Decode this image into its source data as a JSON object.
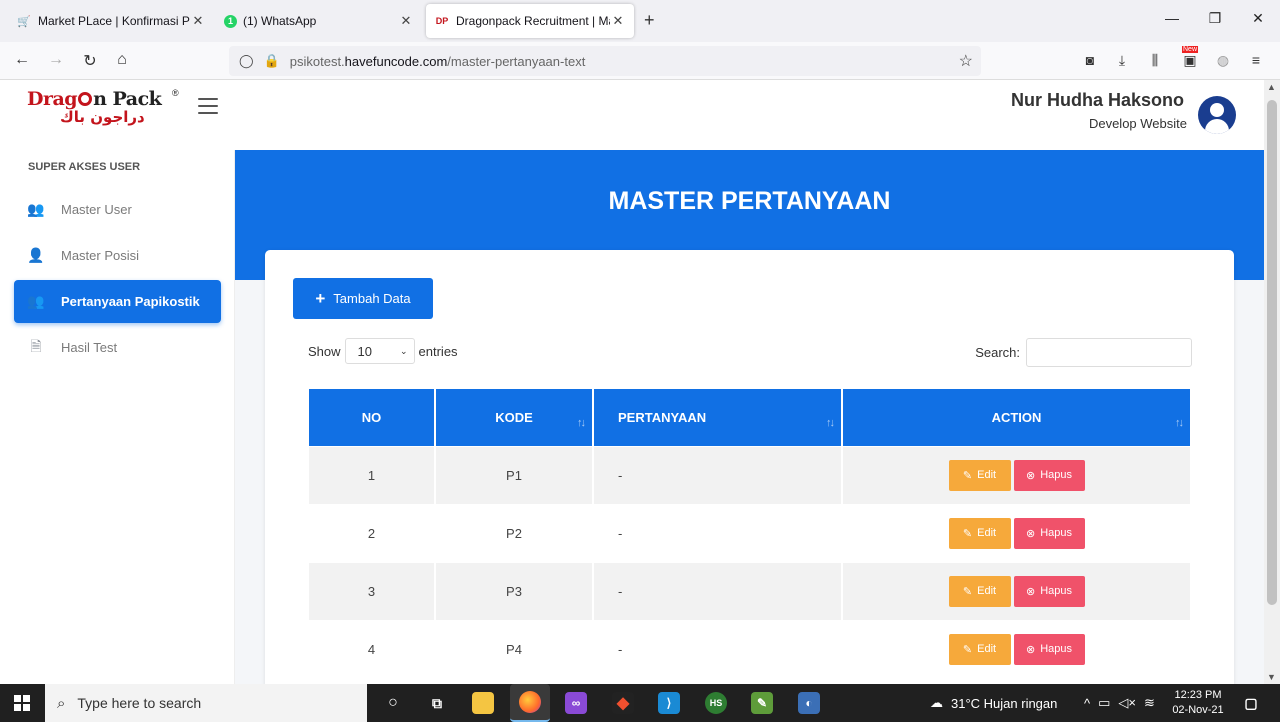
{
  "browser": {
    "tabs": [
      {
        "label": "Market PLace | Konfirmasi Pemb",
        "icon": "cart-icon"
      },
      {
        "label": "(1) WhatsApp",
        "icon": "whatsapp-icon",
        "badge": "1"
      },
      {
        "label": "Dragonpack Recruitment | Mast",
        "icon": "dragonpack-icon"
      }
    ],
    "url_prefix": "psikotest.",
    "url_host": "havefuncode.com",
    "url_path": "/master-pertanyaan-text",
    "new_badge": "New"
  },
  "header": {
    "logo_text_1": "Drag",
    "logo_text_2": "n Pack",
    "logo_arabic": "دراجون باك",
    "logo_reg": "®",
    "user_name": "Nur Hudha Haksono",
    "user_role": "Develop Website"
  },
  "sidebar": {
    "section_title": "SUPER AKSES USER",
    "items": [
      {
        "label": "Master User",
        "icon": "users-icon"
      },
      {
        "label": "Master Posisi",
        "icon": "user-plus-icon"
      },
      {
        "label": "Pertanyaan Papikostik",
        "icon": "users-cog-icon"
      },
      {
        "label": "Hasil Test",
        "icon": "file-icon"
      }
    ]
  },
  "main": {
    "page_title": "MASTER PERTANYAAN",
    "add_button": "Tambah Data",
    "show_label": "Show",
    "entries_value": "10",
    "entries_label": "entries",
    "search_label": "Search:",
    "table": {
      "headers": [
        "NO",
        "KODE",
        "PERTANYAAN",
        "ACTION"
      ],
      "rows": [
        {
          "no": "1",
          "kode": "P1",
          "pertanyaan": "-"
        },
        {
          "no": "2",
          "kode": "P2",
          "pertanyaan": "-"
        },
        {
          "no": "3",
          "kode": "P3",
          "pertanyaan": "-"
        },
        {
          "no": "4",
          "kode": "P4",
          "pertanyaan": "-"
        }
      ],
      "edit_label": "Edit",
      "delete_label": "Hapus"
    }
  },
  "taskbar": {
    "search_placeholder": "Type here to search",
    "weather": "31°C  Hujan ringan",
    "time": "12:23 PM",
    "date": "02-Nov-21"
  },
  "colors": {
    "primary": "#1170e4",
    "edit": "#f6a93b",
    "delete": "#f0526a",
    "brand_red": "#c3141c"
  }
}
